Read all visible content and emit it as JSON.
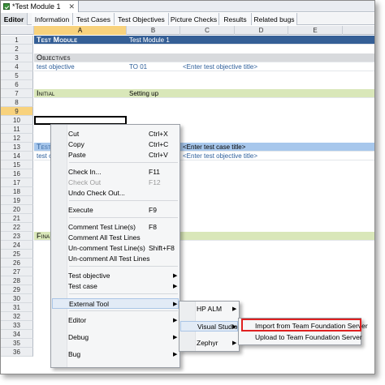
{
  "document_tab": {
    "title": "*Test Module 1",
    "close": "✕"
  },
  "sub_tabs": [
    "Editor",
    "Information",
    "Test Cases",
    "Test Objectives",
    "Picture Checks",
    "Results",
    "Related bugs"
  ],
  "columns": [
    "A",
    "B",
    "C",
    "D",
    "E"
  ],
  "rows": [
    "1",
    "2",
    "3",
    "4",
    "5",
    "6",
    "7",
    "8",
    "9",
    "10",
    "11",
    "12",
    "13",
    "14",
    "15",
    "16",
    "17",
    "18",
    "19",
    "20",
    "21",
    "22",
    "23",
    "24",
    "25",
    "26",
    "27",
    "28",
    "29",
    "30",
    "31",
    "32",
    "33",
    "34",
    "35",
    "36"
  ],
  "cells": {
    "r1_a": "Test Module",
    "r1_b": "Test Module 1",
    "r3_a": "Objectives",
    "r4_a": "test objective",
    "r4_b": "TO 01",
    "r4_c": "<Enter test objective title>",
    "r7_a": "Initial",
    "r7_b": "Setting up",
    "r12_a": "Test",
    "r12_c": "<Enter test case title>",
    "r13_a": "test o",
    "r13_c": "<Enter test objective title>",
    "r23_a": "Fina"
  },
  "context_menu": {
    "items": [
      {
        "label": "Cut",
        "shortcut": "Ctrl+X"
      },
      {
        "label": "Copy",
        "shortcut": "Ctrl+C"
      },
      {
        "label": "Paste",
        "shortcut": "Ctrl+V"
      },
      {
        "label": "Check In...",
        "shortcut": "F11"
      },
      {
        "label": "Check Out",
        "shortcut": "F12"
      },
      {
        "label": "Undo Check Out...",
        "shortcut": ""
      },
      {
        "label": "Execute",
        "shortcut": "F9"
      },
      {
        "label": "Comment Test Line(s)",
        "shortcut": "F8"
      },
      {
        "label": "Comment All Test Lines",
        "shortcut": ""
      },
      {
        "label": "Un-comment Test Line(s)",
        "shortcut": "Shift+F8"
      },
      {
        "label": "Un-comment All Test Lines",
        "shortcut": ""
      },
      {
        "label": "Test objective",
        "shortcut": ""
      },
      {
        "label": "Test case",
        "shortcut": ""
      },
      {
        "label": "External Tool",
        "shortcut": ""
      },
      {
        "label": "Editor",
        "shortcut": ""
      },
      {
        "label": "Debug",
        "shortcut": ""
      },
      {
        "label": "Bug",
        "shortcut": ""
      }
    ],
    "submenu_arrow": "▶"
  },
  "external_tool_menu": {
    "items": [
      "HP ALM",
      "Visual Studio",
      "Zephyr"
    ]
  },
  "visual_studio_menu": {
    "items": [
      "Import from Team Foundation Server",
      "Upload to Team Foundation Server"
    ]
  },
  "colors": {
    "title_bar": "#355f96",
    "section_gray": "#d8dadd",
    "section_green": "#d9e7b9",
    "highlight_row": "#a7c7ec",
    "selected_header": "#f8d27d",
    "link_text": "#2d5e9a",
    "red_highlight": "#e02020"
  }
}
